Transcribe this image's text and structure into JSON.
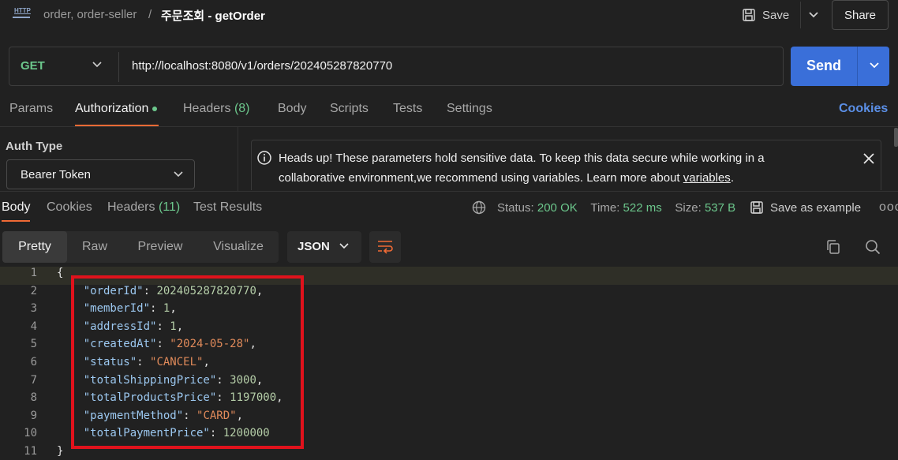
{
  "header": {
    "collection": "order, order-seller",
    "separator": "/",
    "request_name": "주문조회 - getOrder",
    "save_label": "Save",
    "share_label": "Share",
    "http_badge": "HTTP"
  },
  "url_bar": {
    "method": "GET",
    "url": "http://localhost:8080/v1/orders/202405287820770",
    "send_label": "Send"
  },
  "request_tabs": {
    "params": "Params",
    "authorization": "Authorization",
    "headers": "Headers",
    "headers_count": "(8)",
    "body": "Body",
    "scripts": "Scripts",
    "tests": "Tests",
    "settings": "Settings",
    "cookies": "Cookies"
  },
  "auth": {
    "type_label": "Auth Type",
    "type_value": "Bearer Token",
    "notice_text": "Heads up! These parameters hold sensitive data. To keep this data secure while working in a collaborative environment,we recommend using variables. Learn more about ",
    "notice_link": "variables",
    "notice_end": "."
  },
  "response_tabs": {
    "body": "Body",
    "cookies": "Cookies",
    "headers": "Headers",
    "headers_count": "(11)",
    "test_results": "Test Results"
  },
  "response_meta": {
    "status_label": "Status:",
    "status_value": "200 OK",
    "time_label": "Time:",
    "time_value": "522 ms",
    "size_label": "Size:",
    "size_value": "537 B",
    "save_example": "Save as example",
    "more": "ooo"
  },
  "view": {
    "pretty": "Pretty",
    "raw": "Raw",
    "preview": "Preview",
    "visualize": "Visualize",
    "format": "JSON"
  },
  "code_lines": [
    {
      "n": "1",
      "text": "{"
    },
    {
      "n": "2",
      "key": "\"orderId\"",
      "val": "202405287820770",
      "vtype": "num",
      "comma": true
    },
    {
      "n": "3",
      "key": "\"memberId\"",
      "val": "1",
      "vtype": "num",
      "comma": true
    },
    {
      "n": "4",
      "key": "\"addressId\"",
      "val": "1",
      "vtype": "num",
      "comma": true
    },
    {
      "n": "5",
      "key": "\"createdAt\"",
      "val": "\"2024-05-28\"",
      "vtype": "str",
      "comma": true
    },
    {
      "n": "6",
      "key": "\"status\"",
      "val": "\"CANCEL\"",
      "vtype": "str",
      "comma": true
    },
    {
      "n": "7",
      "key": "\"totalShippingPrice\"",
      "val": "3000",
      "vtype": "num",
      "comma": true
    },
    {
      "n": "8",
      "key": "\"totalProductsPrice\"",
      "val": "1197000",
      "vtype": "num",
      "comma": true
    },
    {
      "n": "9",
      "key": "\"paymentMethod\"",
      "val": "\"CARD\"",
      "vtype": "str",
      "comma": true
    },
    {
      "n": "10",
      "key": "\"totalPaymentPrice\"",
      "val": "1200000",
      "vtype": "num",
      "comma": false
    },
    {
      "n": "11",
      "text": "}"
    }
  ]
}
